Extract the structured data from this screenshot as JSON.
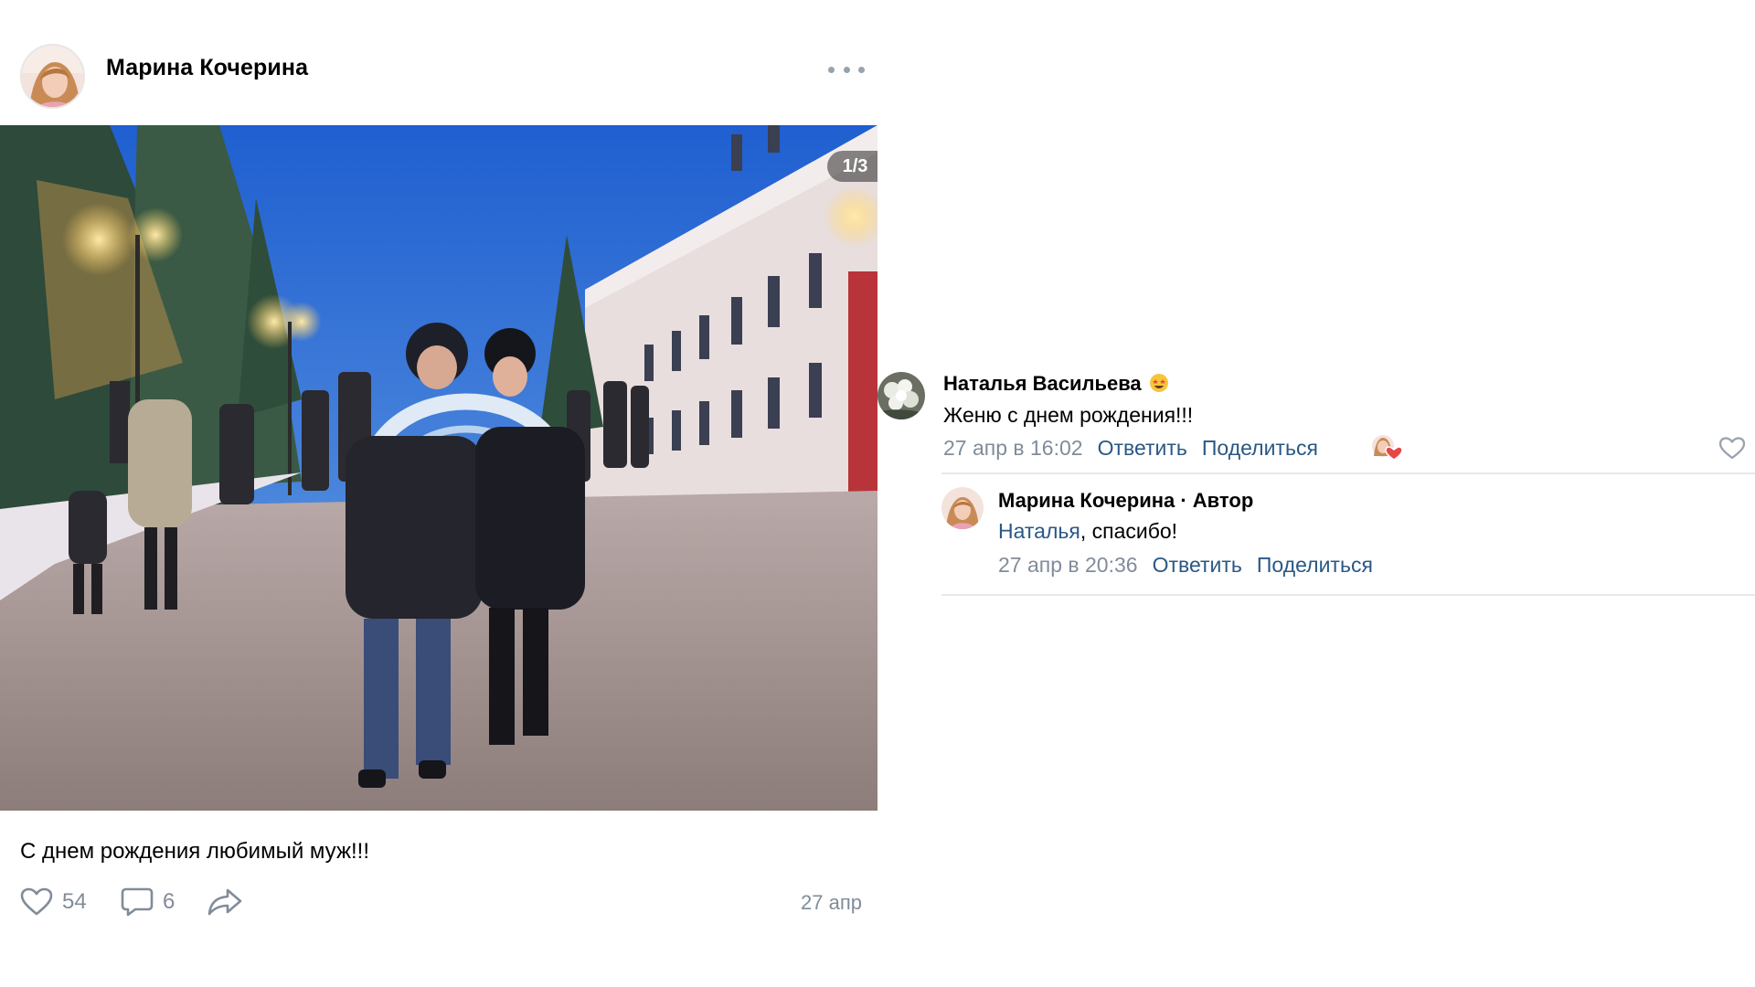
{
  "post": {
    "author": "Марина Кочерина",
    "photo_counter": "1/3",
    "caption": "С днем рождения любимый муж!!!",
    "likes": "54",
    "comments": "6",
    "date": "27 апр"
  },
  "comments": [
    {
      "author": "Наталья Васильева",
      "emoji": "star-struck-emoji",
      "text": "Женю с днем рождения!!!",
      "date": "27 апр в 16:02",
      "reply_label": "Ответить",
      "share_label": "Поделиться"
    },
    {
      "author": "Марина Кочерина · Автор",
      "mention": "Наталья",
      "text_rest": ", спасибо!",
      "date": "27 апр в 20:36",
      "reply_label": "Ответить",
      "share_label": "Поделиться"
    }
  ],
  "colors": {
    "link": "#2a5885",
    "meta": "#818c99",
    "heart": "#e64646"
  }
}
